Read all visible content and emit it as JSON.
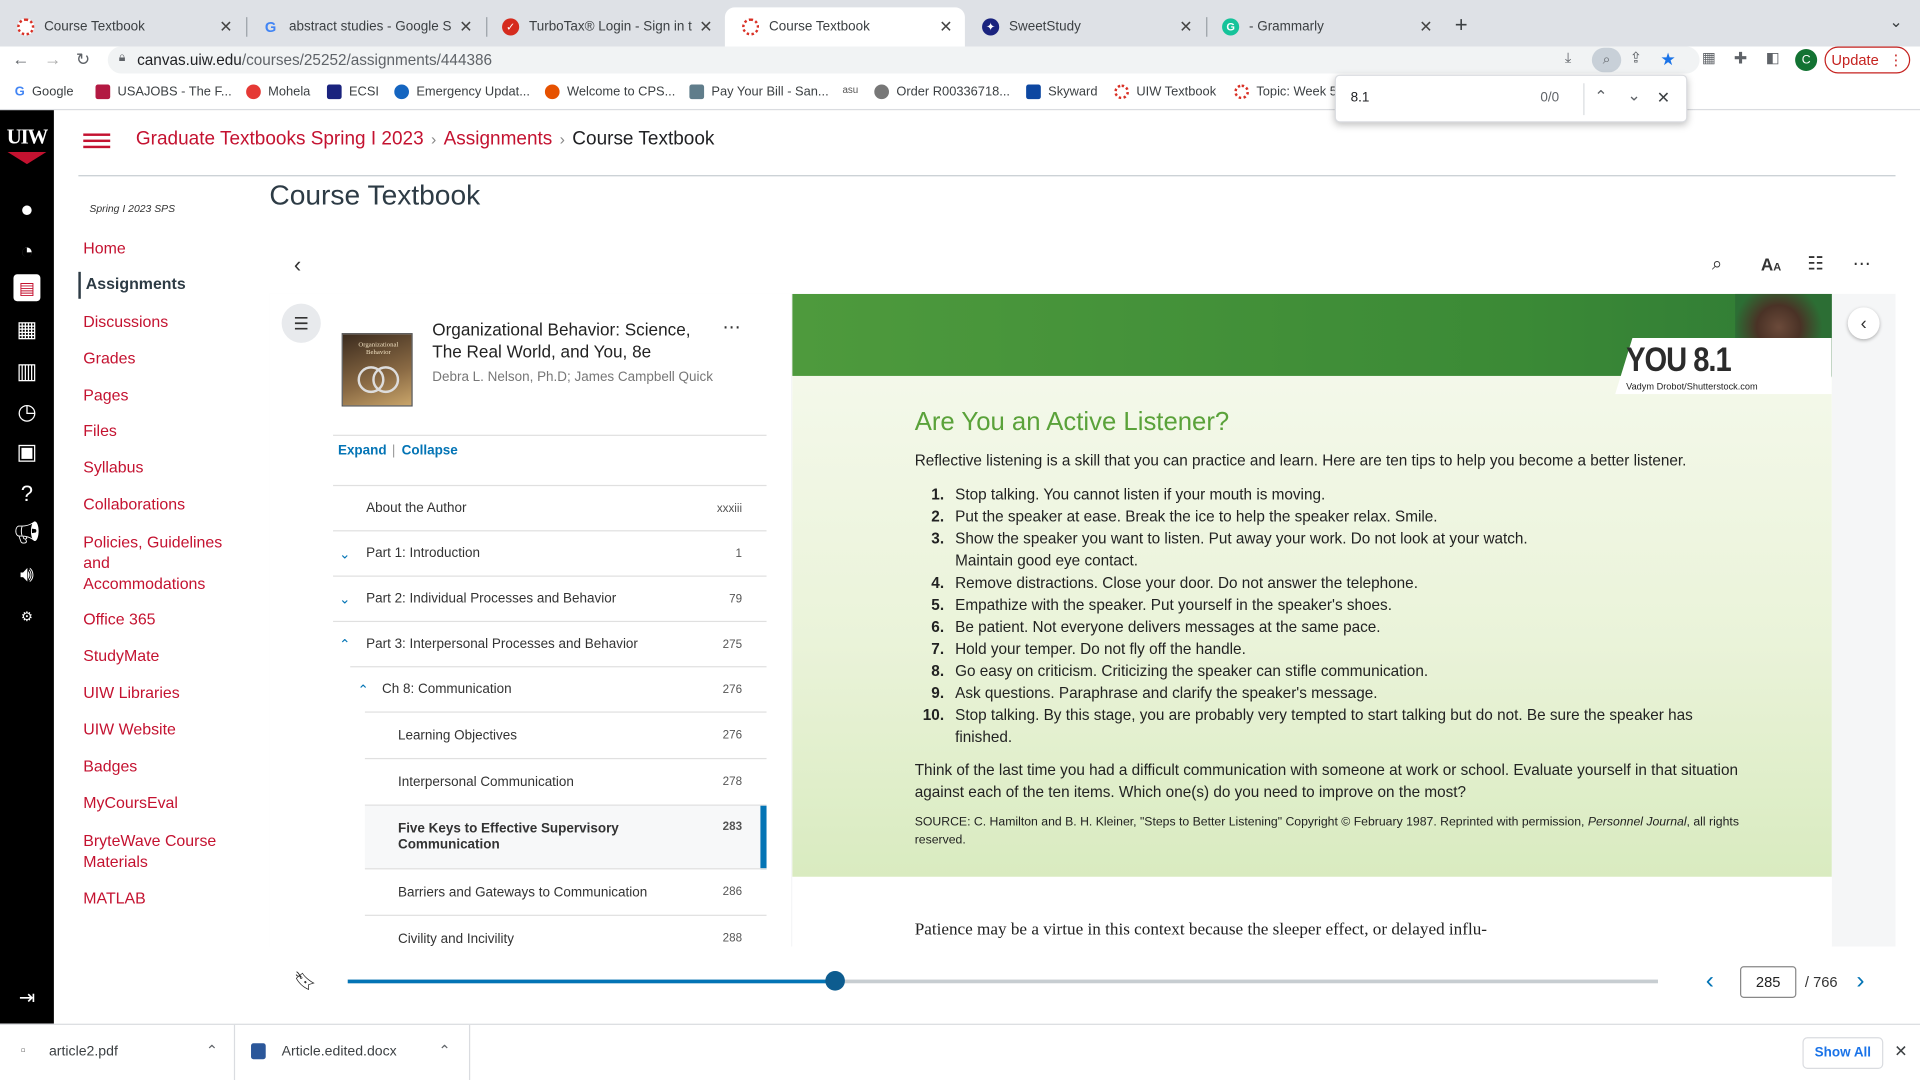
{
  "browser": {
    "tabs": [
      {
        "title": "Course Textbook",
        "icon": "canvas-icon"
      },
      {
        "title": "abstract studies - Google Sear",
        "icon": "google-icon"
      },
      {
        "title": "TurboTax® Login - Sign in to Ge",
        "icon": "turbotax-icon"
      },
      {
        "title": "Course Textbook",
        "icon": "canvas-icon",
        "active": true
      },
      {
        "title": "SweetStudy",
        "icon": "sweetstudy-icon"
      },
      {
        "title": "- Grammarly",
        "icon": "grammarly-icon"
      }
    ],
    "url_host": "canvas.uiw.edu",
    "url_path": "/courses/25252/assignments/444386",
    "update_label": "Update",
    "profile_initial": "C",
    "bookmarks": [
      "Google",
      "USAJOBS - The F...",
      "Mohela",
      "ECSI",
      "Emergency Updat...",
      "Welcome to CPS...",
      "Pay Your Bill - San...",
      "asu",
      "Order R00336718...",
      "Skyward",
      "UIW Textbook",
      "Topic: Week 5"
    ],
    "find": {
      "query": "8.1",
      "count": "0/0"
    }
  },
  "canvas": {
    "logo": "UIW",
    "breadcrumb": [
      "Graduate Textbooks Spring I 2023",
      "Assignments",
      "Course Textbook"
    ],
    "term": "Spring I 2023 SPS",
    "nav": [
      "Home",
      "Assignments",
      "Discussions",
      "Grades",
      "Pages",
      "Files",
      "Syllabus",
      "Collaborations",
      "Policies, Guidelines and Accommodations",
      "Office 365",
      "StudyMate",
      "UIW Libraries",
      "UIW Website",
      "Badges",
      "MyCoursEval",
      "BryteWave Course Materials",
      "MATLAB"
    ],
    "page_title": "Course Textbook"
  },
  "book": {
    "title": "Organizational Behavior: Science, The Real World, and You, 8e",
    "authors": "Debra L. Nelson, Ph.D; James Campbell Quick",
    "cover_text": "Organizational Behavior",
    "expand_label": "Expand",
    "collapse_label": "Collapse",
    "toc_sep": "|",
    "toc": [
      {
        "label": "About the Author",
        "page": "xxxiii"
      },
      {
        "label": "Part 1: Introduction",
        "page": "1"
      },
      {
        "label": "Part 2: Individual Processes and Behavior",
        "page": "79"
      },
      {
        "label": "Part 3: Interpersonal Processes and Behavior",
        "page": "275"
      },
      {
        "label": "Ch 8: Communication",
        "page": "276"
      },
      {
        "label": "Learning Objectives",
        "page": "276"
      },
      {
        "label": "Interpersonal Communication",
        "page": "278"
      },
      {
        "label": "Five Keys to Effective Supervisory Communication",
        "page": "283"
      },
      {
        "label": "Barriers and Gateways to Communication",
        "page": "286"
      },
      {
        "label": "Civility and Incivility",
        "page": "288"
      }
    ]
  },
  "page": {
    "badge": "YOU 8.1",
    "photo_credit": "Vadym Drobot/Shutterstock.com",
    "heading": "Are You an Active Listener?",
    "intro": "Reflective listening is a skill that you can practice and learn. Here are ten tips to help you become a better listener.",
    "tips": [
      {
        "n": "1.",
        "t": "Stop talking. You cannot listen if your mouth is moving."
      },
      {
        "n": "2.",
        "t": "Put the speaker at ease. Break the ice to help the speaker relax. Smile."
      },
      {
        "n": "3.",
        "t": "Show the speaker you want to listen. Put away your work. Do not look at your watch. Maintain good eye contact."
      },
      {
        "n": "4.",
        "t": "Remove distractions. Close your door. Do not answer the telephone."
      },
      {
        "n": "5.",
        "t": "Empathize with the speaker. Put yourself in the speaker's shoes."
      },
      {
        "n": "6.",
        "t": "Be patient. Not everyone delivers messages at the same pace."
      },
      {
        "n": "7.",
        "t": "Hold your temper. Do not fly off the handle."
      },
      {
        "n": "8.",
        "t": "Go easy on criticism. Criticizing the speaker can stifle communication."
      },
      {
        "n": "9.",
        "t": "Ask questions. Paraphrase and clarify the speaker's message."
      },
      {
        "n": "10.",
        "t": "Stop talking. By this stage, you are probably very tempted to start talking but do not. Be sure the speaker has finished."
      }
    ],
    "closing": "Think of the last time you had a difficult communication with someone at work or school. Evaluate yourself in that situation against each of the ten items. Which one(s) do you need to improve on the most?",
    "source_pre": "SOURCE: C. Hamilton and B. H. Kleiner, \"Steps to Better Listening\" Copyright © February 1987. Reprinted with permission, ",
    "source_journal": "Personnel Journal",
    "source_post": ", all rights reserved.",
    "body_text": "Patience may be a virtue in this context because the sleeper effect, or delayed influ-"
  },
  "reader": {
    "current_page": "285",
    "total_pages": "/ 766",
    "progress": 0.372
  },
  "downloads": {
    "files": [
      "article2.pdf",
      "Article.edited.docx"
    ],
    "show_all": "Show All"
  }
}
